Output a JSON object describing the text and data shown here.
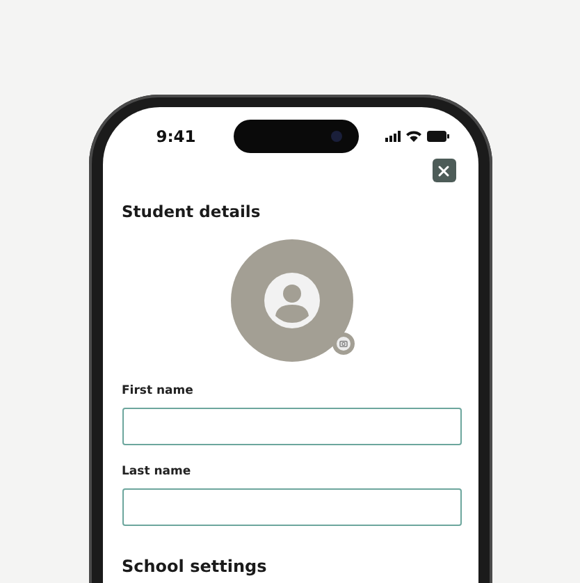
{
  "status_bar": {
    "time": "9:41"
  },
  "title": "Student details",
  "fields": [
    {
      "label": "First name"
    },
    {
      "label": "Last name"
    }
  ],
  "section_heading": "School settings"
}
